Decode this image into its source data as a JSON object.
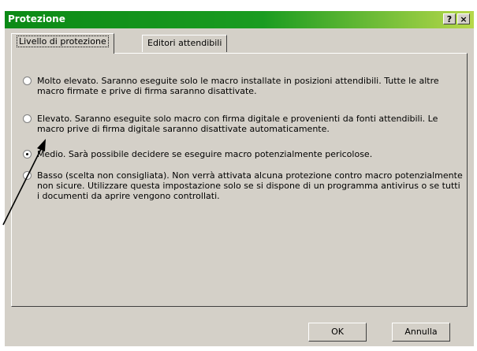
{
  "window": {
    "title": "Protezione",
    "help_label": "?",
    "close_label": "×"
  },
  "tabs": [
    {
      "label": "Livello di protezione",
      "active": true
    },
    {
      "label": "Editori attendibili",
      "active": false
    }
  ],
  "options": [
    {
      "text": "Molto elevato. Saranno eseguite solo le macro installate in posizioni attendibili. Tutte le altre macro firmate e prive di firma saranno disattivate.",
      "checked": false
    },
    {
      "text": "Elevato. Saranno eseguite solo macro con firma digitale e provenienti da fonti attendibili. Le macro prive di firma digitale saranno disattivate automaticamente.",
      "checked": false
    },
    {
      "text": "Medio. Sarà possibile decidere se eseguire macro potenzialmente pericolose.",
      "checked": true
    },
    {
      "text": "Basso (scelta non consigliata). Non verrà attivata alcuna protezione contro macro potenzialmente non sicure. Utilizzare questa impostazione solo se si dispone di un programma antivirus o se tutti i documenti da aprire vengono controllati.",
      "checked": false
    }
  ],
  "buttons": {
    "ok": "OK",
    "cancel": "Annulla"
  }
}
